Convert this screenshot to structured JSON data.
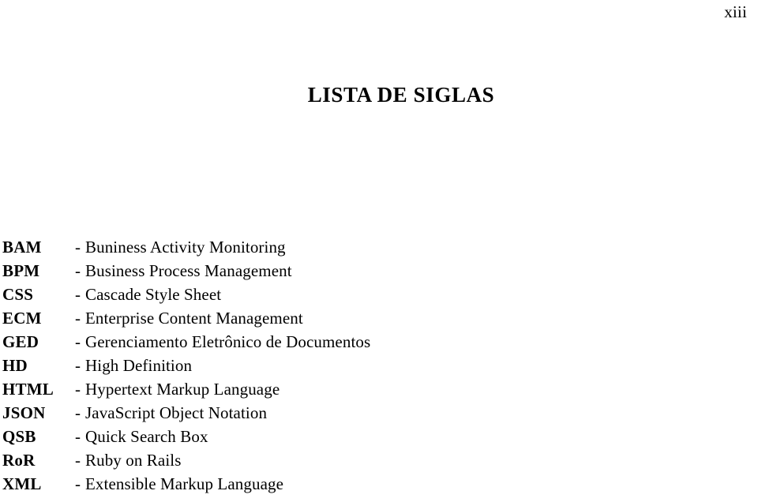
{
  "document": {
    "page_number": "xiii",
    "section_title": "LISTA DE SIGLAS",
    "separator": "-"
  },
  "abbreviations": [
    {
      "term": "BAM",
      "definition": "Buniness Activity Monitoring"
    },
    {
      "term": "BPM",
      "definition": "Business Process Management"
    },
    {
      "term": "CSS",
      "definition": "Cascade Style Sheet"
    },
    {
      "term": "ECM",
      "definition": "Enterprise Content Management"
    },
    {
      "term": "GED",
      "definition": "Gerenciamento Eletrônico de Documentos"
    },
    {
      "term": "HD",
      "definition": "High Definition"
    },
    {
      "term": "HTML",
      "definition": "Hypertext Markup Language"
    },
    {
      "term": "JSON",
      "definition": "JavaScript Object Notation"
    },
    {
      "term": "QSB",
      "definition": "Quick Search Box"
    },
    {
      "term": "RoR",
      "definition": "Ruby on Rails"
    },
    {
      "term": "XML",
      "definition": "Extensible Markup Language"
    }
  ]
}
